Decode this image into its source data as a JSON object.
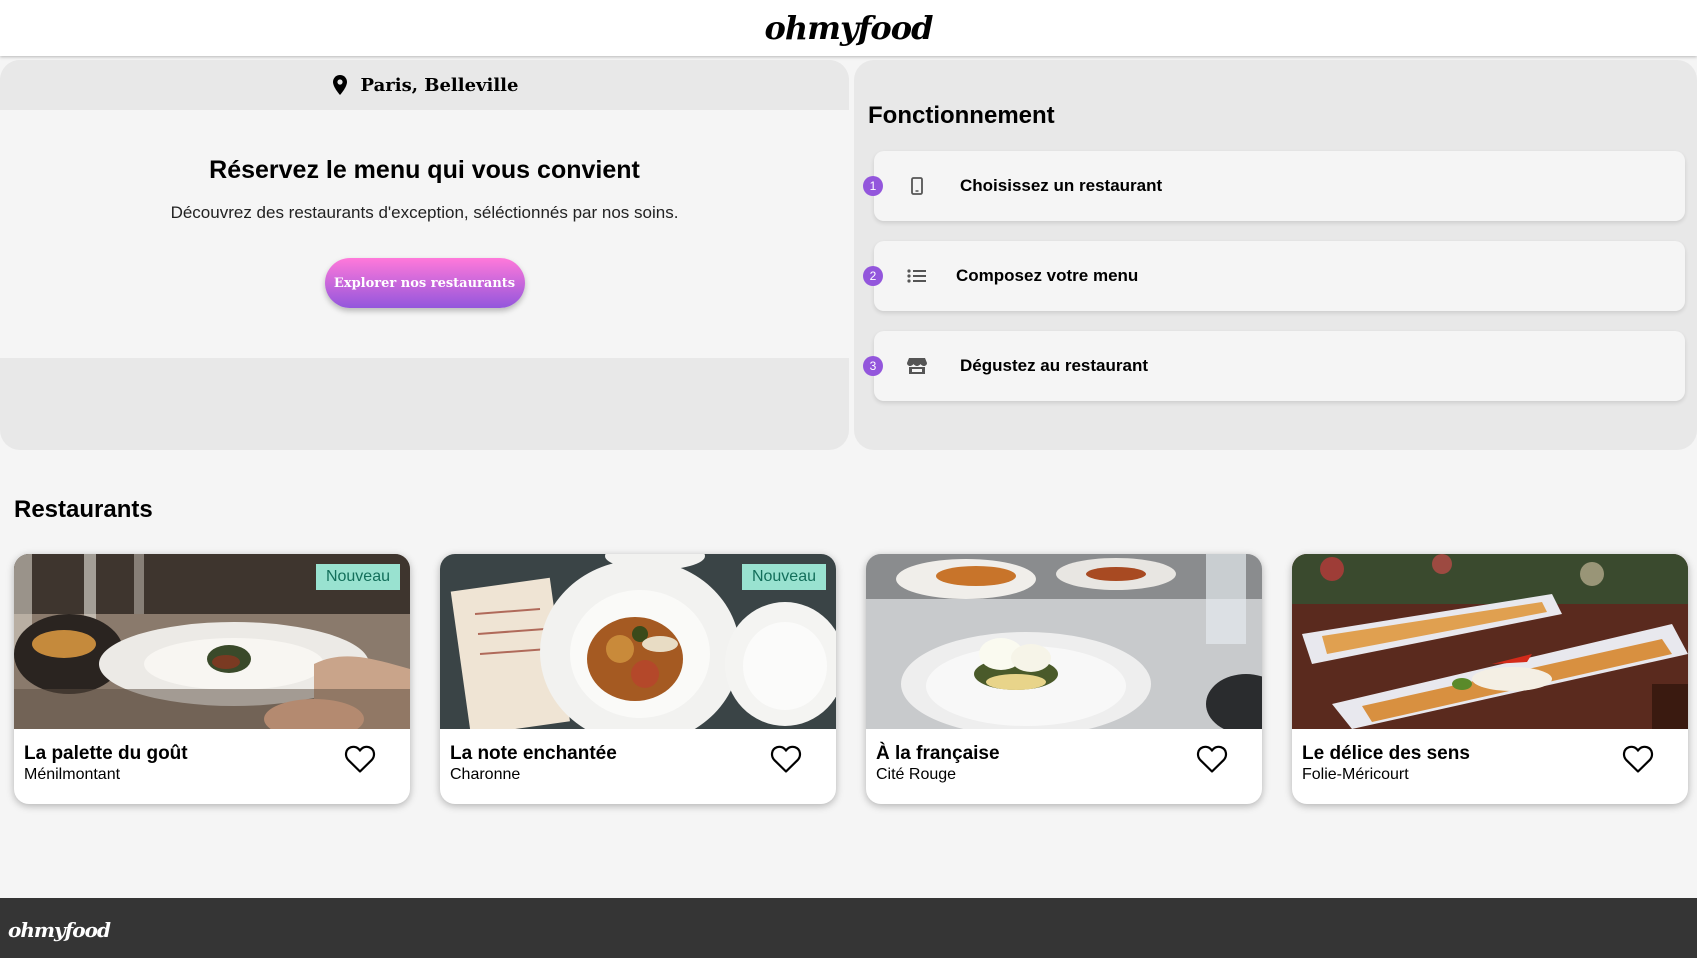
{
  "header": {
    "logo": "ohmyfood"
  },
  "location": {
    "text": "Paris, Belleville",
    "icon": "map-pin-icon"
  },
  "hero": {
    "title": "Réservez le menu qui vous convient",
    "subtitle": "Découvrez des restaurants d'exception, séléctionnés par nos soins.",
    "button_label": "Explorer nos restaurants"
  },
  "how_it_works": {
    "title": "Fonctionnement",
    "accent_color": "#9356dc",
    "steps": [
      {
        "number": "1",
        "label": "Choisissez un restaurant",
        "icon": "mobile-phone-icon"
      },
      {
        "number": "2",
        "label": "Composez votre menu",
        "icon": "list-icon"
      },
      {
        "number": "3",
        "label": "Dégustez au restaurant",
        "icon": "storefront-icon"
      }
    ]
  },
  "restaurants": {
    "title": "Restaurants",
    "items": [
      {
        "name": "La palette du goût",
        "location": "Ménilmontant",
        "badge": "Nouveau",
        "favorite_icon": "heart-outline-icon"
      },
      {
        "name": "La note enchantée",
        "location": "Charonne",
        "badge": "Nouveau",
        "favorite_icon": "heart-outline-icon"
      },
      {
        "name": "À la française",
        "location": "Cité Rouge",
        "badge": "",
        "favorite_icon": "heart-outline-icon"
      },
      {
        "name": "Le délice des sens",
        "location": "Folie-Méricourt",
        "badge": "",
        "favorite_icon": "heart-outline-icon"
      }
    ]
  },
  "footer": {
    "logo": "ohmyfood"
  },
  "colors": {
    "button_gradient_start": "#ff79da",
    "button_gradient_end": "#9356dc",
    "badge_bg": "#99e2d0",
    "badge_text": "#136f5b",
    "footer_bg": "#353535"
  }
}
